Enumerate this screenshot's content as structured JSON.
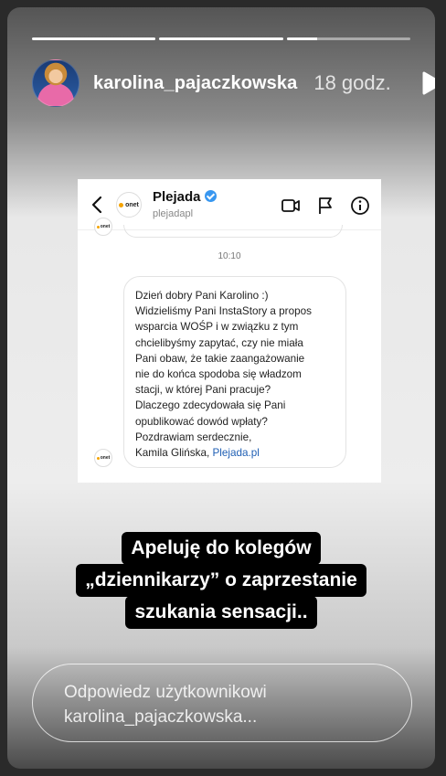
{
  "story": {
    "progress": [
      1,
      1,
      0.25
    ],
    "username": "karolina_pajaczkowska",
    "time_ago": "18 godz."
  },
  "screenshot": {
    "account_name": "Plejada",
    "account_handle": "plejadapl",
    "logo_text": "onet",
    "message_time": "10:10",
    "message_lines": [
      "Dzień dobry Pani Karolino :)",
      "Widzieliśmy Pani InstaStory a propos",
      "wsparcia WOŚP i w związku z tym",
      "chcielibyśmy zapytać, czy nie miała",
      "Pani obaw, że takie zaangażowanie",
      "nie do końca spodoba się władzom",
      "stacji, w której Pani pracuje?",
      "Dlaczego zdecydowała się Pani",
      "opublikować dowód wpłaty?",
      "Pozdrawiam serdecznie,"
    ],
    "signature": "Kamila Glińska,",
    "signature_link": "Plejada.pl"
  },
  "caption": {
    "lines": [
      "Apeluję do kolegów",
      "„dziennikarzy” o zaprzestanie",
      "szukania sensacji.."
    ]
  },
  "reply": {
    "placeholder_line1": "Odpowiedz użytkownikowi",
    "placeholder_line2": "karolina_pajaczkowska..."
  }
}
